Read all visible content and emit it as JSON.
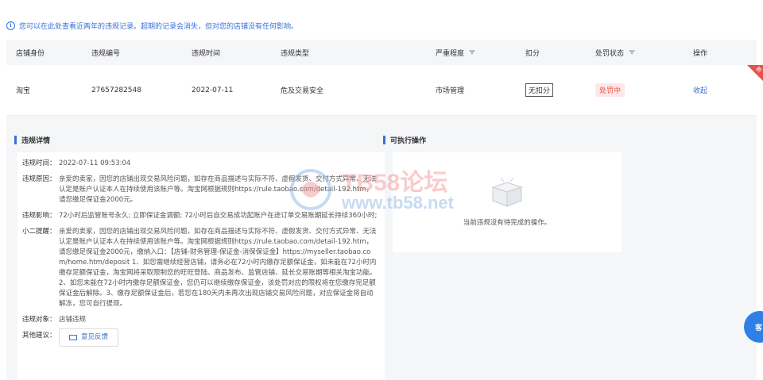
{
  "notice": "您可以在此处查看近两年的违规记录。超期的记录会消失，但对您的店铺没有任何影响。",
  "table": {
    "headers": [
      "店铺身份",
      "违规编号",
      "违规时间",
      "违规类型",
      "严重程度",
      "扣分",
      "处罚状态",
      "操作"
    ],
    "row": {
      "shop": "淘宝",
      "id": "27657282548",
      "time": "2022-07-11",
      "type": "危及交易安全",
      "severity": "市场管理",
      "deduct": "无扣分",
      "status": "处罚中",
      "action": "收起",
      "badge": "新"
    }
  },
  "detail": {
    "title": "违规详情",
    "items": [
      {
        "k": "违规时间：",
        "v": "2022-07-11 09:53:04"
      },
      {
        "k": "违规原因：",
        "v": "亲爱的卖家，因您的店铺出现交易风险问题，如存在商品描述与实际不符、虚假发货、交付方式异常、无法认定是账户认证本人在持续使用该账户等。淘宝网根据规则https://rule.taobao.com/detail-192.htm，请您缴足保证金2000元。"
      },
      {
        "k": "违规影响：",
        "v": "72小时后监管账号永久; 立即保证金调额; 72小时后自交易成功起账户在途订单交易账期延长持续360小时;"
      },
      {
        "k": "小二提醒：",
        "v": "亲爱的卖家，因您的店铺出现交易风险问题，如存在商品描述与实际不符、虚假发货、交付方式异常、无法认定是账户认证本人在持续使用该账户等。淘宝网根据规则https://rule.taobao.com/detail-192.htm，请您缴足保证金2000元，缴纳入口：【店铺-财务管理-保证金-消保保证金】https://myseller.taobao.com/home.htm/deposit 1、如您需继续经营店铺，请务必在72小时内缴存足额保证金，如未能在72小时内缴存足额保证金，淘宝网将采取限制您的旺旺登陆、商品发布、监管店铺、延长交易账期等相关淘宝功能。2、如您未能在72小时内缴存足额保证金，您仍可以继续缴存保证金，该处罚对应的限权将在您缴存完足额保证金后解除。3、缴存足额保证金后，若您在180天内未再次出现店铺交易风险问题，对应保证金将自动解冻，您可自行提现。"
      },
      {
        "k": "违规对象：",
        "v": "店铺违规"
      }
    ],
    "other_label": "其他建议：",
    "feedback_label": "意见反馈"
  },
  "actions": {
    "title": "可执行操作",
    "empty_text": "当前违规没有待完成的操作。"
  },
  "watermark": {
    "title": "TB58论坛",
    "url": "www.tb58.net"
  },
  "float_button": "客",
  "colors": {
    "accent": "#3a6fd8",
    "danger": "#e8504a",
    "panel_bg": "#f5f6f8"
  }
}
